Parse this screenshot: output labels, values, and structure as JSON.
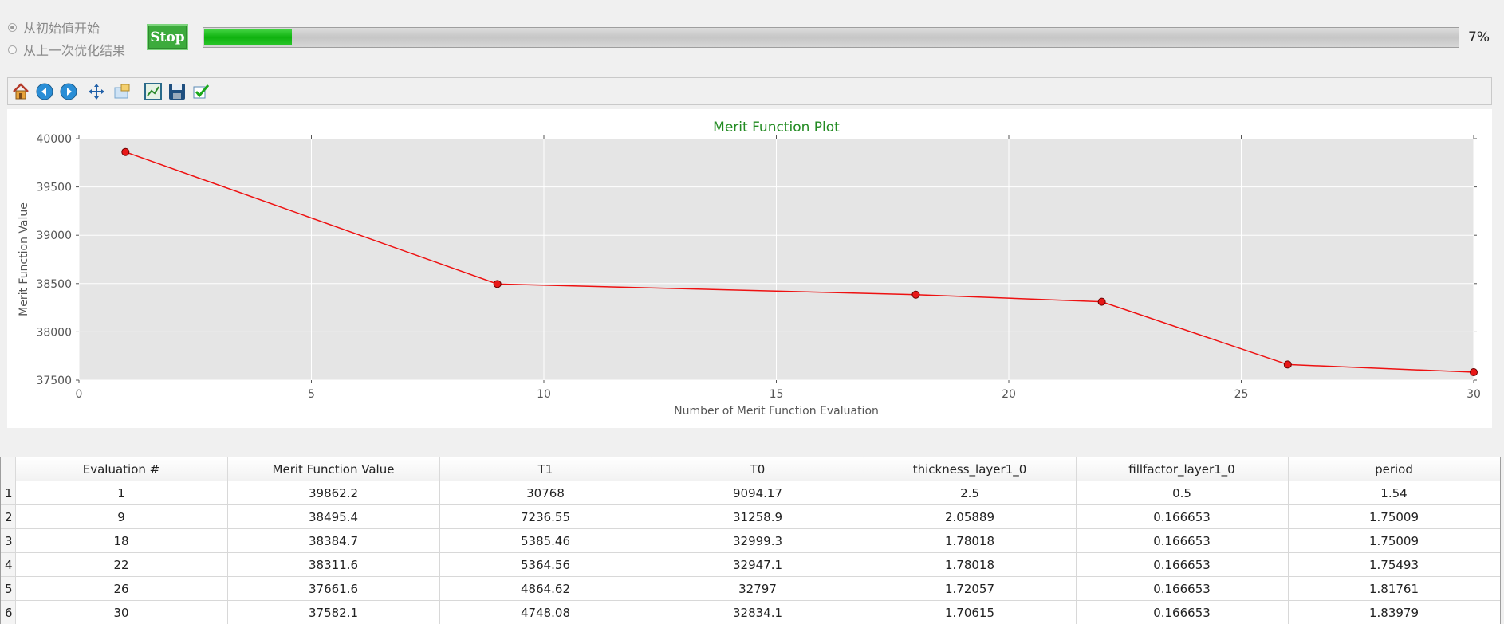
{
  "controls": {
    "radio_options": [
      {
        "label": "从初始值开始",
        "selected": true
      },
      {
        "label": "从上一次优化结果",
        "selected": false
      }
    ],
    "stop_label": "Stop",
    "progress_percent": 7,
    "progress_text": "7%"
  },
  "toolbar": {
    "icons": [
      "home-icon",
      "back-icon",
      "forward-icon",
      "pan-icon",
      "zoom-icon",
      "configure-subplots-icon",
      "save-icon",
      "apply-icon"
    ]
  },
  "chart_data": {
    "type": "line",
    "title": "Merit Function Plot",
    "xlabel": "Number of Merit Function Evaluation",
    "ylabel": "Merit Function Value",
    "xlim": [
      0,
      30
    ],
    "ylim": [
      37500,
      40000
    ],
    "xticks": [
      0,
      5,
      10,
      15,
      20,
      25,
      30
    ],
    "yticks": [
      37500,
      38000,
      38500,
      39000,
      39500,
      40000
    ],
    "grid": true,
    "x": [
      1,
      9,
      18,
      22,
      26,
      30
    ],
    "y": [
      39862.2,
      38495.4,
      38384.7,
      38311.6,
      37661.6,
      37582.1
    ],
    "colors": {
      "line": "#ee1111",
      "title": "#228b22",
      "plot_bg": "#e5e5e5",
      "grid": "#ffffff"
    }
  },
  "table": {
    "columns": [
      "Evaluation #",
      "Merit Function Value",
      "T1",
      "T0",
      "thickness_layer1_0",
      "fillfactor_layer1_0",
      "period"
    ],
    "row_headers": [
      "1",
      "2",
      "3",
      "4",
      "5",
      "6"
    ],
    "rows": [
      [
        "1",
        "39862.2",
        "30768",
        "9094.17",
        "2.5",
        "0.5",
        "1.54"
      ],
      [
        "9",
        "38495.4",
        "7236.55",
        "31258.9",
        "2.05889",
        "0.166653",
        "1.75009"
      ],
      [
        "18",
        "38384.7",
        "5385.46",
        "32999.3",
        "1.78018",
        "0.166653",
        "1.75009"
      ],
      [
        "22",
        "38311.6",
        "5364.56",
        "32947.1",
        "1.78018",
        "0.166653",
        "1.75493"
      ],
      [
        "26",
        "37661.6",
        "4864.62",
        "32797",
        "1.72057",
        "0.166653",
        "1.81761"
      ],
      [
        "30",
        "37582.1",
        "4748.08",
        "32834.1",
        "1.70615",
        "0.166653",
        "1.83979"
      ]
    ]
  }
}
